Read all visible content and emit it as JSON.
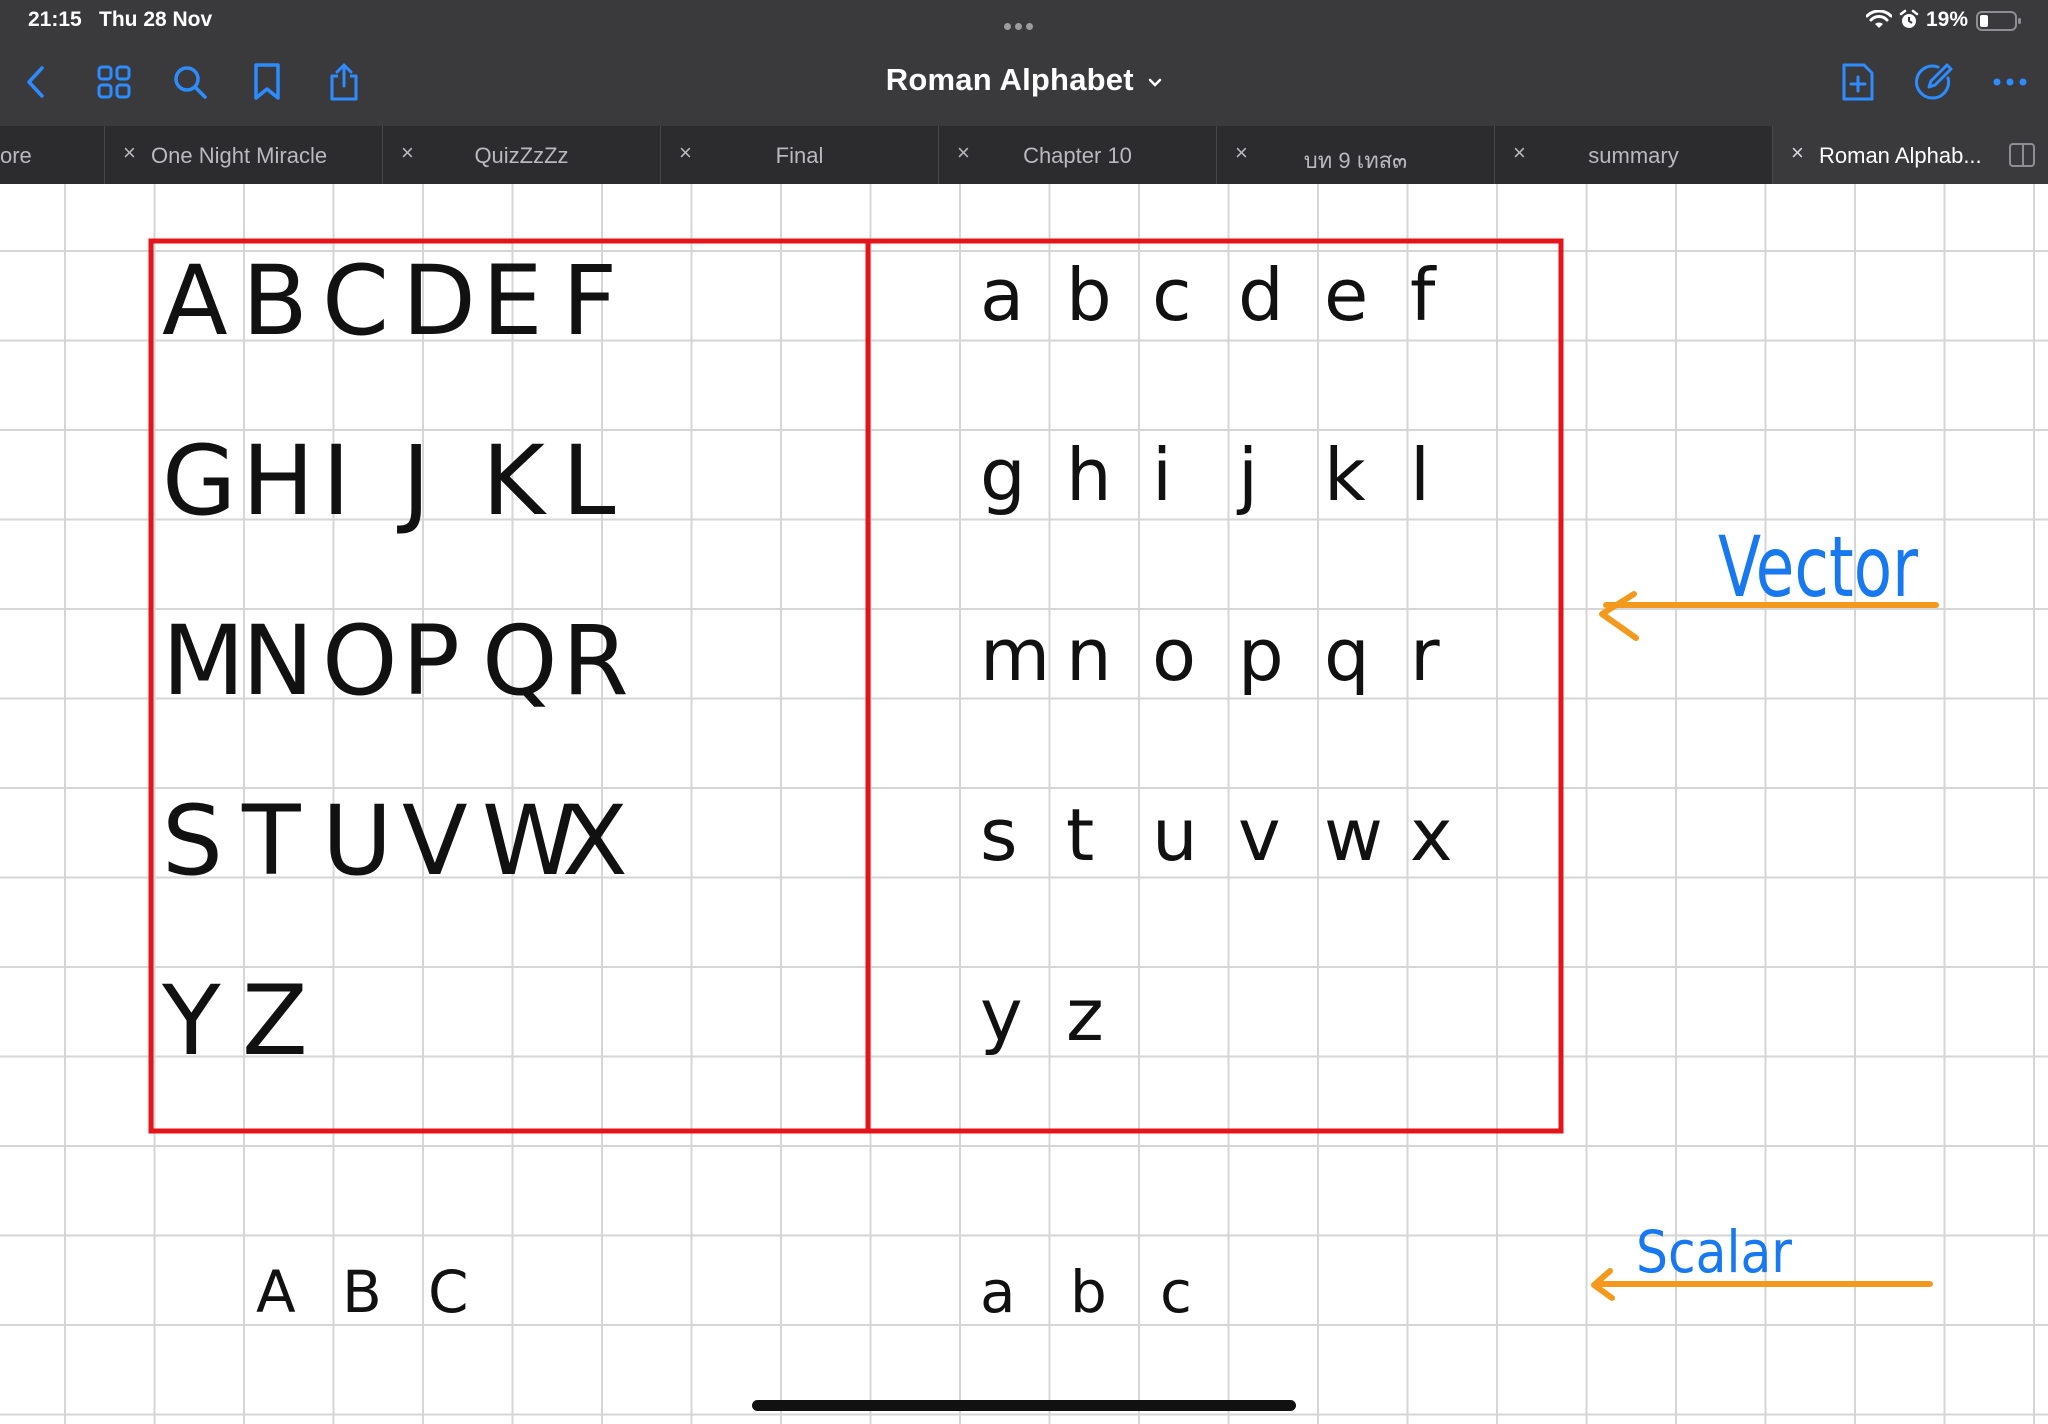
{
  "status_bar": {
    "time": "21:15",
    "date": "Thu 28 Nov",
    "battery": "19%"
  },
  "toolbar": {
    "title": "Roman Alphabet",
    "icons": [
      "back-chevron-icon",
      "grid-view-icon",
      "search-icon",
      "bookmark-icon",
      "share-icon",
      "new-page-icon",
      "pencil-edit-icon",
      "more-icon"
    ],
    "accent_color": "#2d8cff"
  },
  "tabs": [
    {
      "label": "ore",
      "active": false
    },
    {
      "label": "One Night Miracle",
      "active": false
    },
    {
      "label": "QuizZzZz",
      "active": false
    },
    {
      "label": "Final",
      "active": false
    },
    {
      "label": "Chapter 10",
      "active": false
    },
    {
      "label": "บท 9 เทส๓",
      "active": false
    },
    {
      "label": "summary",
      "active": false
    },
    {
      "label": "Roman Alphab...",
      "active": true
    }
  ],
  "note": {
    "uppercase_rows": [
      [
        "A",
        "B",
        "C",
        "D",
        "E",
        "F"
      ],
      [
        "G",
        "H",
        "I",
        "J",
        "K",
        "L"
      ],
      [
        "M",
        "N",
        "O",
        "P",
        "Q",
        "R"
      ],
      [
        "S",
        "T",
        "U",
        "V",
        "W",
        "X"
      ],
      [
        "Y",
        "Z"
      ]
    ],
    "lowercase_rows": [
      [
        "a",
        "b",
        "c",
        "d",
        "e",
        "f"
      ],
      [
        "g",
        "h",
        "i",
        "j",
        "k",
        "l"
      ],
      [
        "m",
        "n",
        "o",
        "p",
        "q",
        "r"
      ],
      [
        "s",
        "t",
        "u",
        "v",
        "w",
        "x"
      ],
      [
        "y",
        "z"
      ]
    ],
    "scalar_upper": [
      "A",
      "B",
      "C"
    ],
    "scalar_lower": [
      "a",
      "b",
      "c"
    ],
    "vector_label": "Vector",
    "scalar_label": "Scalar",
    "box_color": "#e5141b",
    "arrow_color": "#f39a1e",
    "label_color": "#1878f0"
  }
}
